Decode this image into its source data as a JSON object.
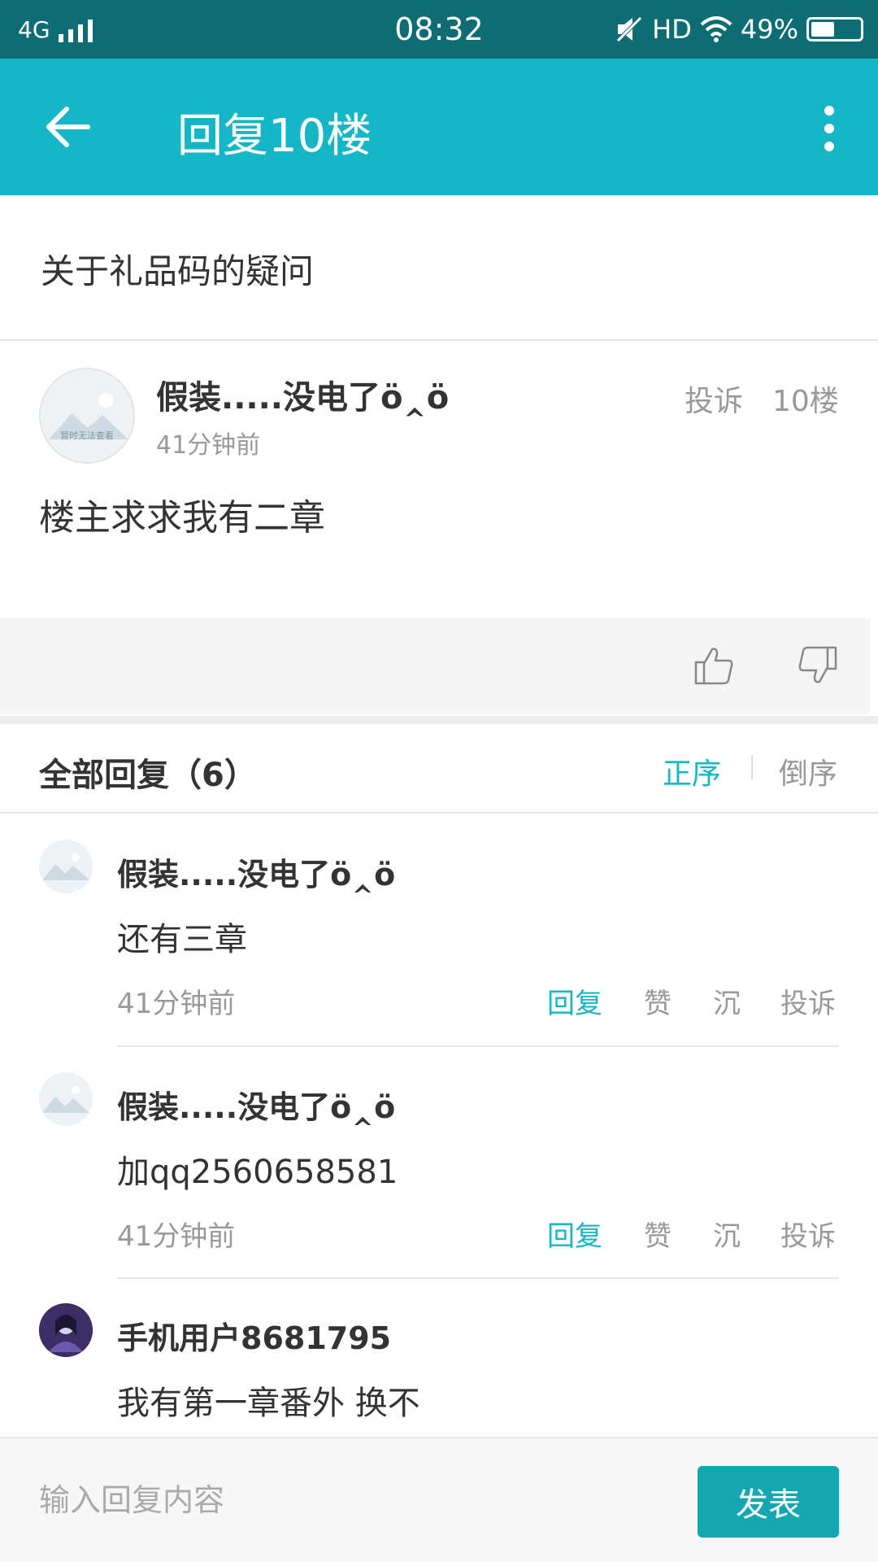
{
  "status_bar": {
    "network": "4G",
    "time": "08:32",
    "hd": "HD",
    "battery_text": "49%",
    "battery_level": 0.49
  },
  "header": {
    "title": "回复10楼",
    "back_icon": "back-arrow-icon",
    "more_icon": "more-vertical-icon"
  },
  "topic": {
    "title": "关于礼品码的疑问"
  },
  "post": {
    "author": "假装.....没电了ö‸ö",
    "time": "41分钟前",
    "report_label": "投诉",
    "floor": "10楼",
    "body": "楼主求求我有二章",
    "avatar_placeholder": "暂时无法查看"
  },
  "replies_section": {
    "header": "全部回复（6）",
    "sort_asc": "正序",
    "sort_desc": "倒序"
  },
  "replies": [
    {
      "author": "假装.....没电了ö‸ö",
      "body": "还有三章",
      "time": "41分钟前",
      "reply_label": "回复",
      "like_label": "赞",
      "sink_label": "沉",
      "report_label": "投诉"
    },
    {
      "author": "假装.....没电了ö‸ö",
      "body": "加qq2560658581",
      "time": "41分钟前",
      "reply_label": "回复",
      "like_label": "赞",
      "sink_label": "沉",
      "report_label": "投诉"
    },
    {
      "author": "手机用户8681795",
      "body": "我有第一章番外 换不"
    }
  ],
  "composer": {
    "placeholder": "输入回复内容",
    "send_label": "发表"
  },
  "colors": {
    "accent": "#15b6c6",
    "status_bar": "#0e6d73",
    "send_button": "#14a6b1"
  }
}
